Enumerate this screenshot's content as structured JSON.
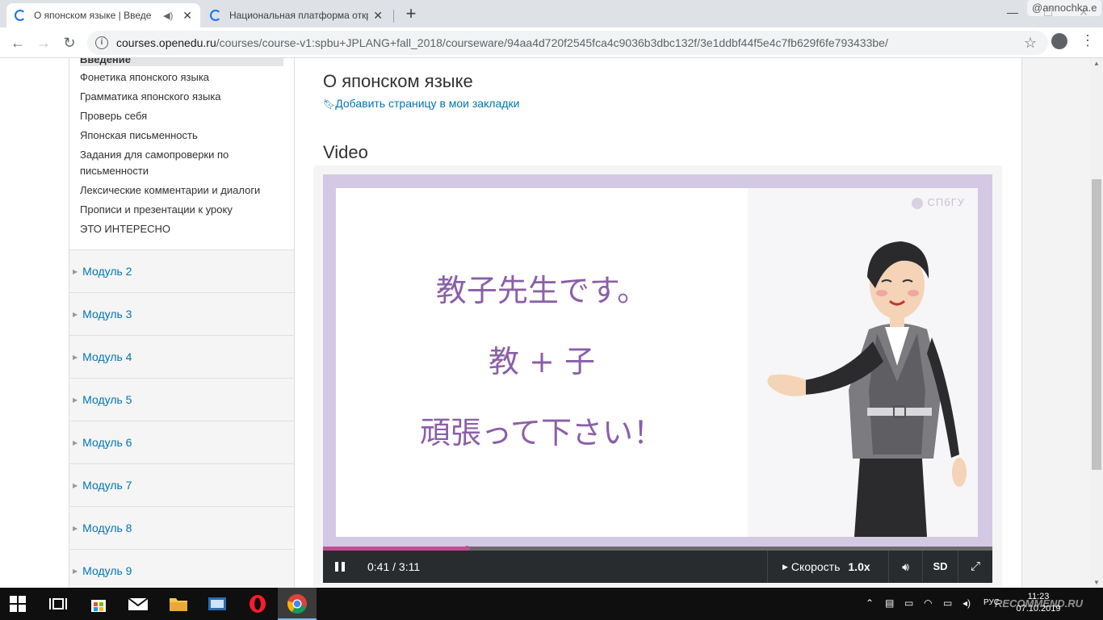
{
  "browser": {
    "tabs": [
      {
        "title": "О японском языке | Введе",
        "active": true
      },
      {
        "title": "Национальная платформа откр",
        "active": false
      }
    ],
    "address": {
      "host": "courses.openedu.ru",
      "path": "/courses/course-v1:spbu+JPLANG+fall_2018/courseware/94aa4d720f2545fca4c9036b3dbc132f/3e1ddbf44f5e4c7fb629f6fe793433be/"
    },
    "profile_name": "@annochka.e"
  },
  "sidebar": {
    "active_item": "Введение",
    "items": [
      "Фонетика японского языка",
      "Грамматика японского языка",
      "Проверь себя",
      "Японская письменность",
      "Задания для самопроверки по",
      "письменности",
      "Лексические комментарии и диалоги",
      "Прописи и презентации к уроку",
      "ЭТО ИНТЕРЕСНО"
    ],
    "modules": [
      "Модуль 2",
      "Модуль 3",
      "Модуль 4",
      "Модуль 5",
      "Модуль 6",
      "Модуль 7",
      "Модуль 8",
      "Модуль 9"
    ]
  },
  "main": {
    "unit_title": "О японском языке",
    "bookmark_label": "Добавить страницу в мои закладки",
    "video_heading": "Video"
  },
  "video": {
    "slide_lines": [
      "教子先生です。",
      "教 + 子",
      "頑張って下さい！"
    ],
    "logo_text": "СПбГУ",
    "current_time": "0:41",
    "duration": "3:11",
    "time_text": "0:41 / 3:11",
    "progress_fraction": 0.215,
    "speed_label": "Скорость",
    "speed_value": "1.0x",
    "quality_label": "SD"
  },
  "taskbar": {
    "clock_time": "11:23",
    "clock_date": "07.10.2019",
    "lang": "РУС",
    "watermark": "RECOMMEND.RU"
  },
  "colors": {
    "link": "#0075b4",
    "slide_text": "#8b5fa8",
    "progress": "#c24e92",
    "controls_bg": "#282c2e"
  }
}
